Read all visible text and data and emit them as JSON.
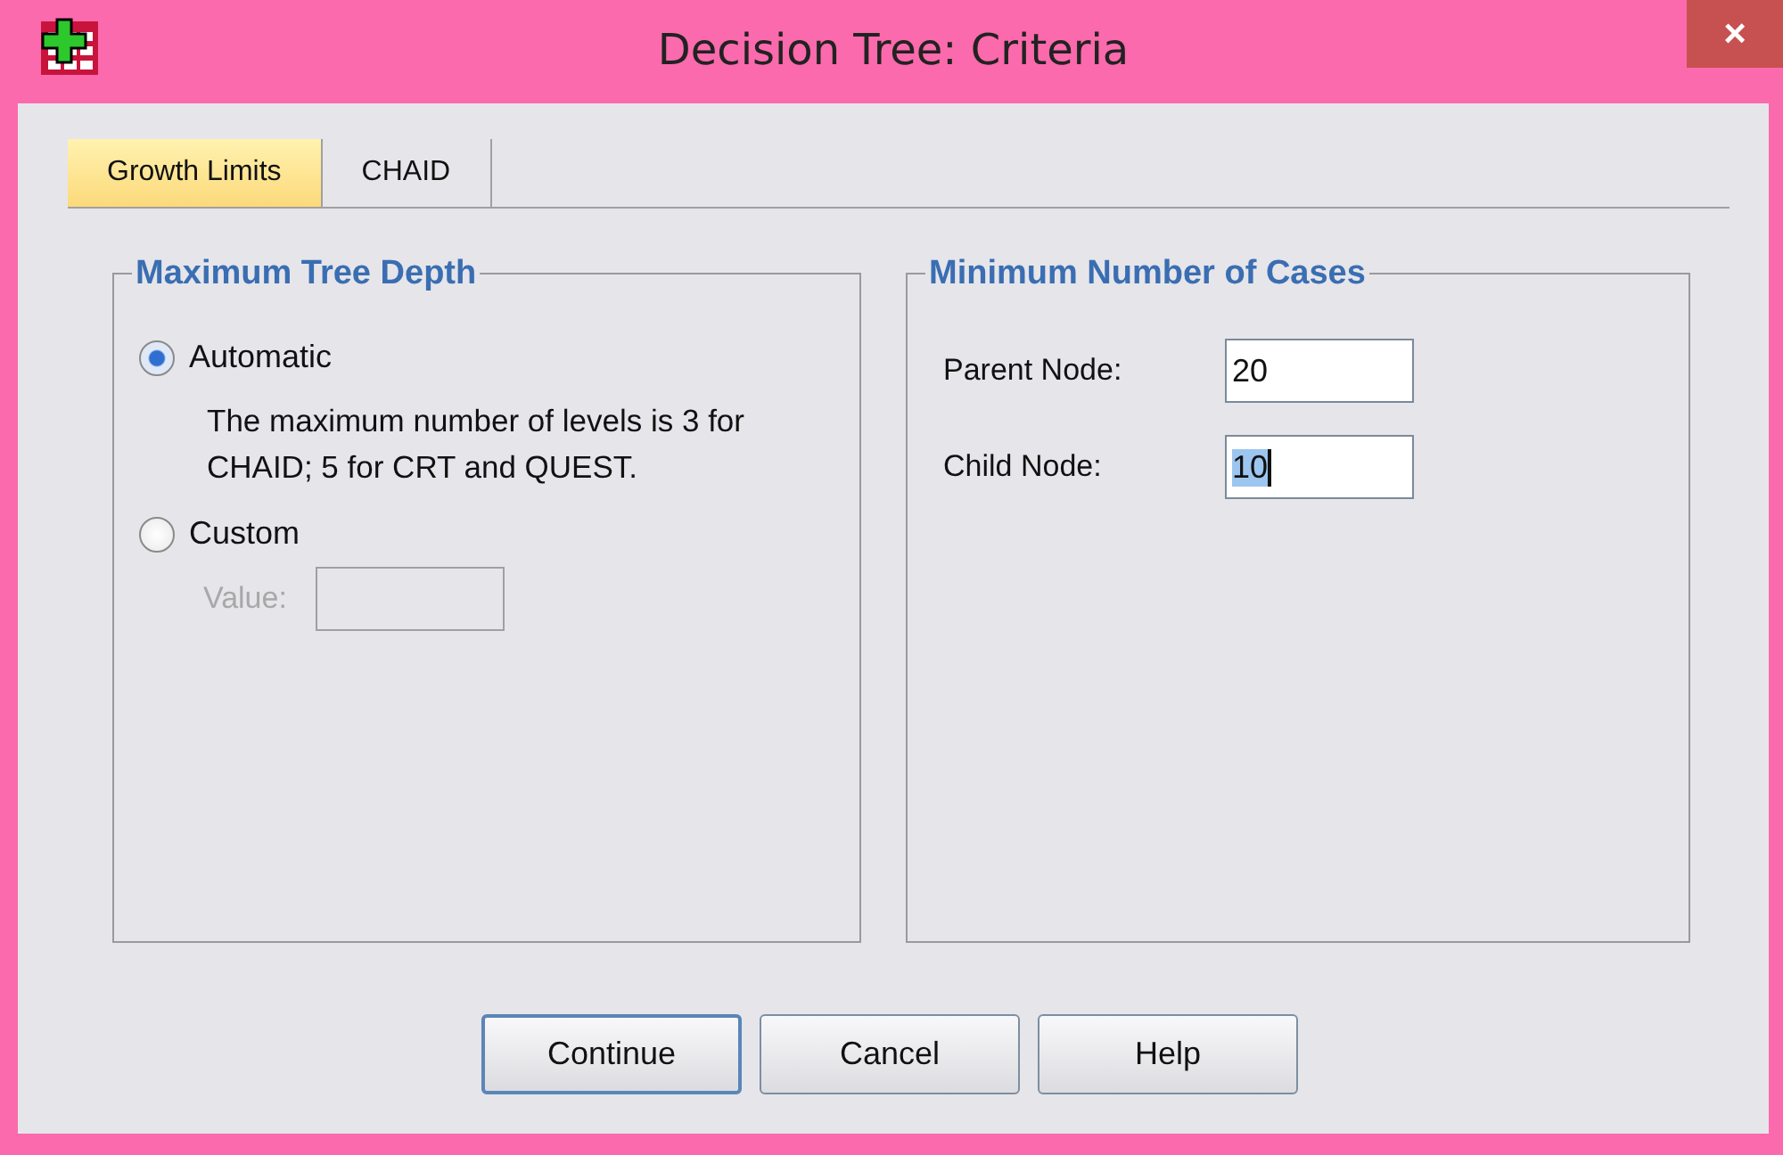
{
  "window": {
    "title": "Decision Tree: Criteria",
    "close": "×"
  },
  "tabs": [
    {
      "label": "Growth Limits",
      "selected": true
    },
    {
      "label": "CHAID",
      "selected": false
    }
  ],
  "depth_group": {
    "title": "Maximum Tree Depth",
    "options": [
      {
        "label": "Automatic",
        "selected": true,
        "note": "The maximum number of levels is 3 for CHAID; 5 for CRT and QUEST."
      },
      {
        "label": "Custom",
        "selected": false
      }
    ],
    "value_field": {
      "label": "Value:",
      "disabled": true
    }
  },
  "cases_group": {
    "title": "Minimum Number of Cases",
    "fields": [
      {
        "label": "Parent Node:",
        "value": "20",
        "text_selected": false
      },
      {
        "label": "Child Node:",
        "value": "10",
        "text_selected": true
      }
    ]
  },
  "buttons": [
    {
      "label": "Continue",
      "default": true
    },
    {
      "label": "Cancel",
      "default": false
    },
    {
      "label": "Help",
      "default": false
    }
  ]
}
